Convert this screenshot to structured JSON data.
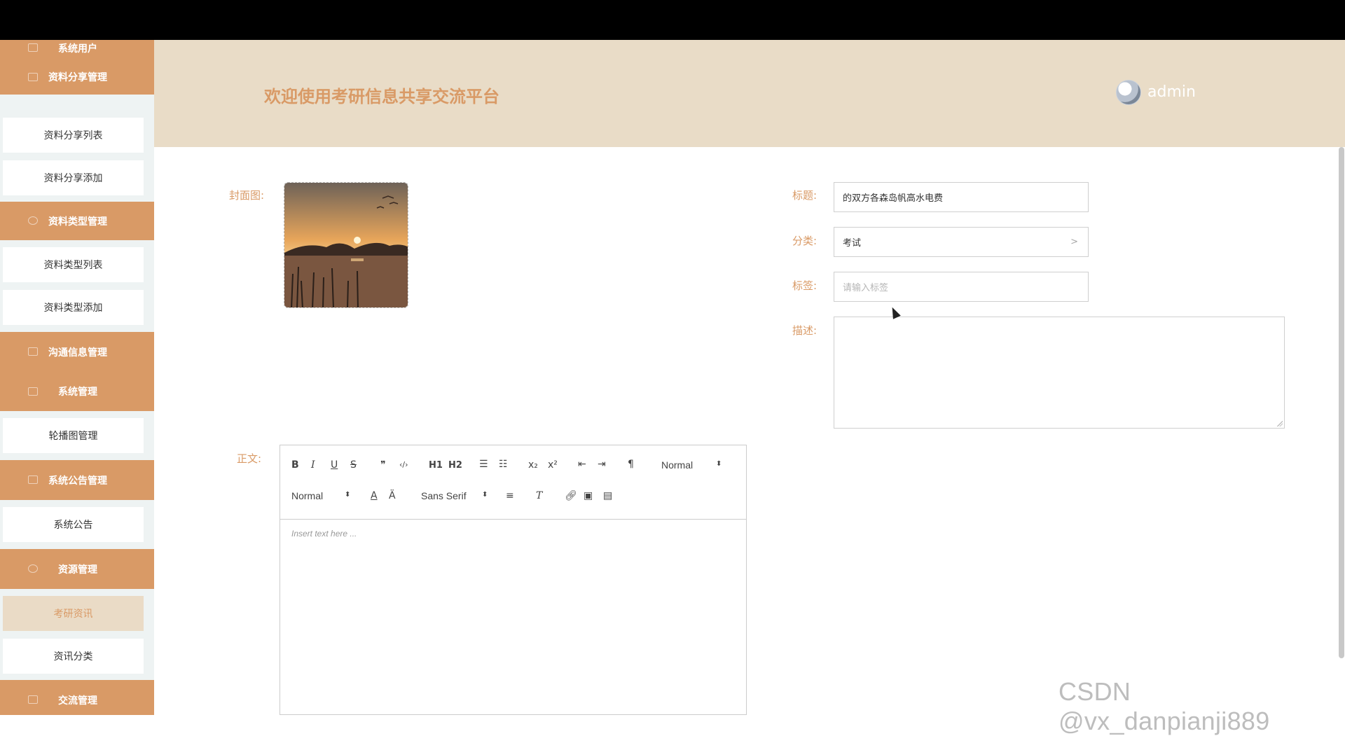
{
  "header": {
    "title": "欢迎使用考研信息共享交流平台",
    "user": "admin"
  },
  "sidebar": {
    "items": [
      {
        "type": "group",
        "label": "系统用户"
      },
      {
        "type": "group",
        "label": "资料分享管理"
      },
      {
        "type": "item",
        "label": "资料分享列表"
      },
      {
        "type": "item",
        "label": "资料分享添加"
      },
      {
        "type": "group",
        "label": "资料类型管理"
      },
      {
        "type": "item",
        "label": "资料类型列表"
      },
      {
        "type": "item",
        "label": "资料类型添加"
      },
      {
        "type": "group",
        "label": "沟通信息管理"
      },
      {
        "type": "group",
        "label": "系统管理"
      },
      {
        "type": "item",
        "label": "轮播图管理"
      },
      {
        "type": "group",
        "label": "系统公告管理"
      },
      {
        "type": "item",
        "label": "系统公告"
      },
      {
        "type": "group",
        "label": "资源管理"
      },
      {
        "type": "item",
        "label": "考研资讯",
        "active": true
      },
      {
        "type": "item",
        "label": "资讯分类"
      },
      {
        "type": "group",
        "label": "交流管理"
      }
    ]
  },
  "form": {
    "cover_label": "封面图:",
    "title_label": "标题:",
    "title_value": "的双方各森岛帆高水电费",
    "category_label": "分类:",
    "category_value": "考试",
    "tags_label": "标签:",
    "tags_placeholder": "请输入标签",
    "desc_label": "描述:",
    "body_label": "正文:"
  },
  "editor": {
    "toolbar_row1": [
      "B",
      "I",
      "U",
      "S",
      "❞",
      "‹/›",
      "H1",
      "H2",
      "ol",
      "ul",
      "x₂",
      "x²",
      "outdent",
      "indent",
      "rtl"
    ],
    "header_select": "Normal",
    "size_select": "Normal",
    "font_select": "Sans Serif",
    "placeholder": "Insert text here ..."
  },
  "watermark": "CSDN @vx_danpianji889",
  "colors": {
    "accent": "#d99a66",
    "header_bg": "#e9dcc7",
    "active_item_bg": "#eadbc6"
  }
}
